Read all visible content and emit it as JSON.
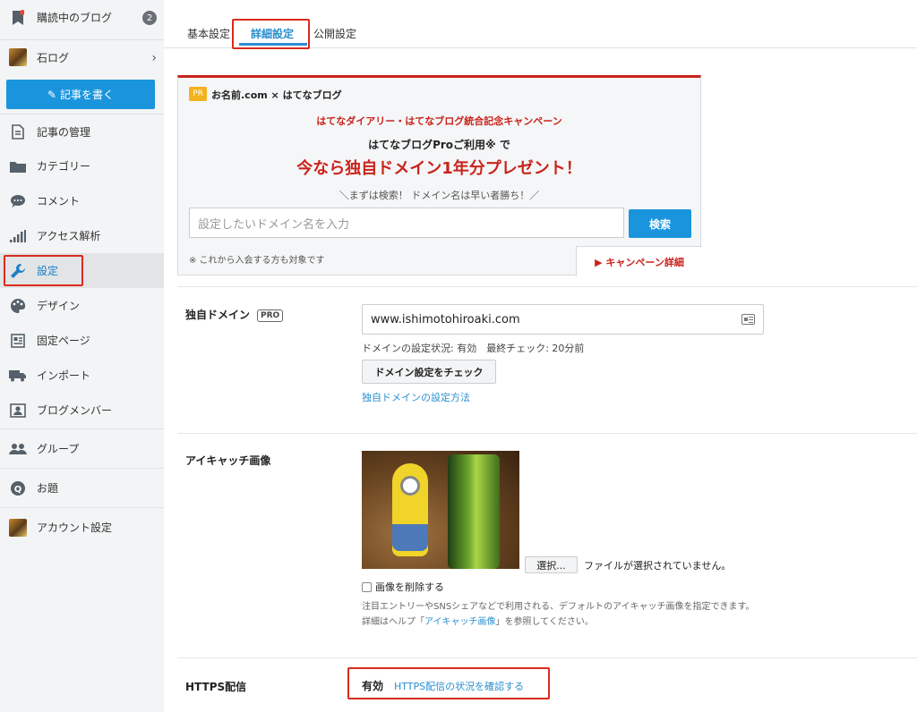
{
  "sidebar": {
    "items": [
      {
        "label": "購読中のブログ",
        "icon": "bookmark-icon",
        "badge": "2"
      },
      {
        "label": "石ログ",
        "icon": "blog-avatar-icon"
      },
      {
        "label": "記事の管理",
        "icon": "document-icon"
      },
      {
        "label": "カテゴリー",
        "icon": "folder-icon"
      },
      {
        "label": "コメント",
        "icon": "comment-icon"
      },
      {
        "label": "アクセス解析",
        "icon": "bar-chart-icon"
      },
      {
        "label": "設定",
        "icon": "wrench-icon"
      },
      {
        "label": "デザイン",
        "icon": "palette-icon"
      },
      {
        "label": "固定ページ",
        "icon": "page-icon"
      },
      {
        "label": "インポート",
        "icon": "truck-icon"
      },
      {
        "label": "ブログメンバー",
        "icon": "member-icon"
      },
      {
        "label": "グループ",
        "icon": "group-icon"
      },
      {
        "label": "お題",
        "icon": "odai-icon"
      },
      {
        "label": "アカウント設定",
        "icon": "account-avatar-icon"
      }
    ],
    "write_button": "記事を書く"
  },
  "tabs": [
    "基本設定",
    "詳細設定",
    "公開設定"
  ],
  "ad": {
    "pr": "PR",
    "brand": "お名前.com × はてなブログ",
    "line1": "はてなダイアリー・はてなブログ統合記念キャンペーン",
    "line2": "はてなブログProご利用※ で",
    "line3": "今なら独自ドメイン1年分プレゼント！",
    "line4": "＼まずは検索！ ドメイン名は早い者勝ち！／",
    "input_placeholder": "設定したいドメイン名を入力",
    "search_button": "検索",
    "note": "※ これから入会する方も対象です",
    "detail_link": "▶ キャンペーン詳細"
  },
  "domain": {
    "label": "独自ドメイン",
    "pro_badge": "PRO",
    "value": "www.ishimotohiroaki.com",
    "status": "ドメインの設定状況: 有効　最終チェック: 20分前",
    "check_button": "ドメイン設定をチェック",
    "help_link": "独自ドメインの設定方法"
  },
  "eyecatch": {
    "label": "アイキャッチ画像",
    "select_button": "選択...",
    "file_status": "ファイルが選択されていません。",
    "delete_label": "画像を削除する",
    "desc_line1": "注目エントリーやSNSシェアなどで利用される、デフォルトのアイキャッチ画像を指定できます。",
    "desc_line2_pre": "詳細はヘルプ「",
    "desc_line2_link": "アイキャッチ画像",
    "desc_line2_post": "」を参照してください。"
  },
  "https": {
    "label": "HTTPS配信",
    "value": "有効",
    "link": "HTTPS配信の状況を確認する"
  }
}
